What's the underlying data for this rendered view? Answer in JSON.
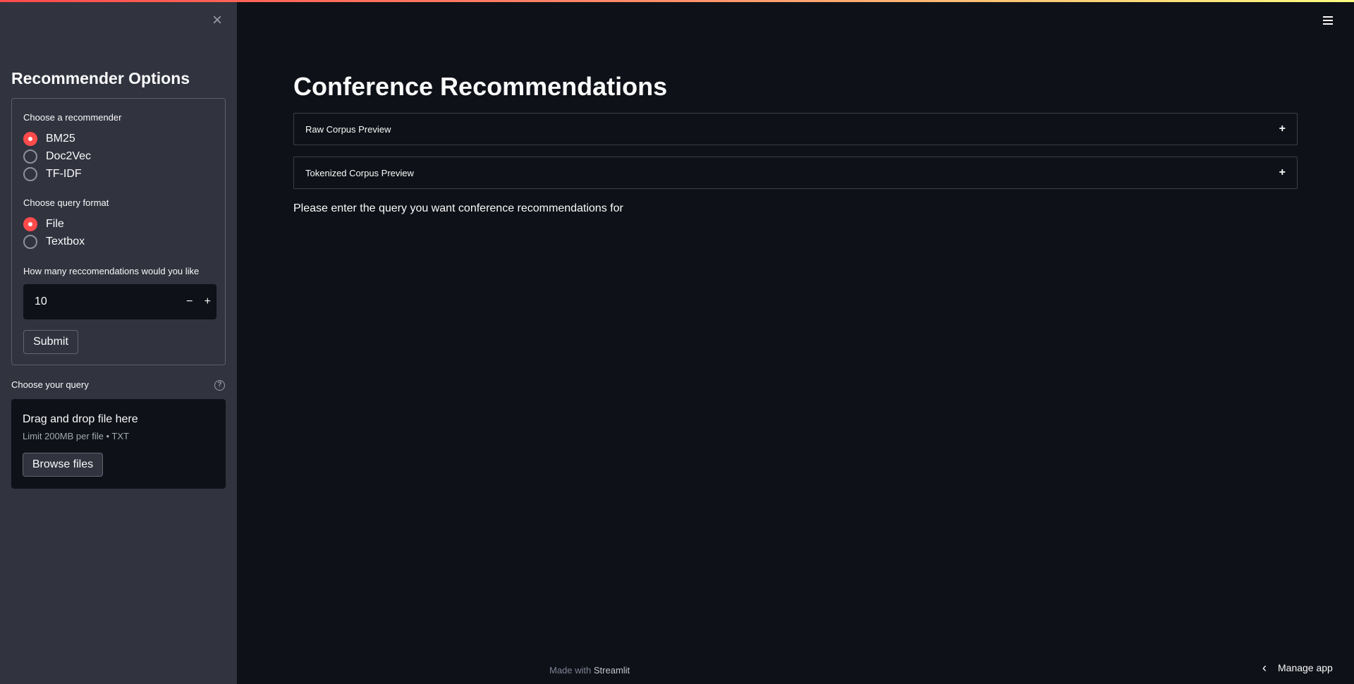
{
  "sidebar": {
    "close_icon": "×",
    "title": "Recommender Options",
    "recommender": {
      "label": "Choose a recommender",
      "options": [
        "BM25",
        "Doc2Vec",
        "TF-IDF"
      ],
      "selected": "BM25"
    },
    "query_format": {
      "label": "Choose query format",
      "options": [
        "File",
        "Textbox"
      ],
      "selected": "File"
    },
    "count": {
      "label": "How many reccomendations would you like",
      "value": "10",
      "minus": "−",
      "plus": "+"
    },
    "submit_label": "Submit",
    "query": {
      "label": "Choose your query",
      "help_icon": "?",
      "drop_title": "Drag and drop file here",
      "drop_sub": "Limit 200MB per file • TXT",
      "browse_label": "Browse files"
    }
  },
  "main": {
    "title": "Conference Recommendations",
    "expanders": [
      {
        "label": "Raw Corpus Preview",
        "icon": "+"
      },
      {
        "label": "Tokenized Corpus Preview",
        "icon": "+"
      }
    ],
    "prompt": "Please enter the query you want conference recommendations for"
  },
  "footer": {
    "made_with": "Made with",
    "brand": "Streamlit"
  },
  "manage_app": {
    "icon": "‹",
    "label": "Manage app"
  },
  "colors": {
    "accent": "#ff4b4b",
    "sidebar_bg": "#31333f",
    "main_bg": "#0e1117"
  },
  "icons": {
    "close": "close-icon",
    "menu": "hamburger-menu-icon",
    "help": "help-icon",
    "chevron": "chevron-left-icon"
  }
}
